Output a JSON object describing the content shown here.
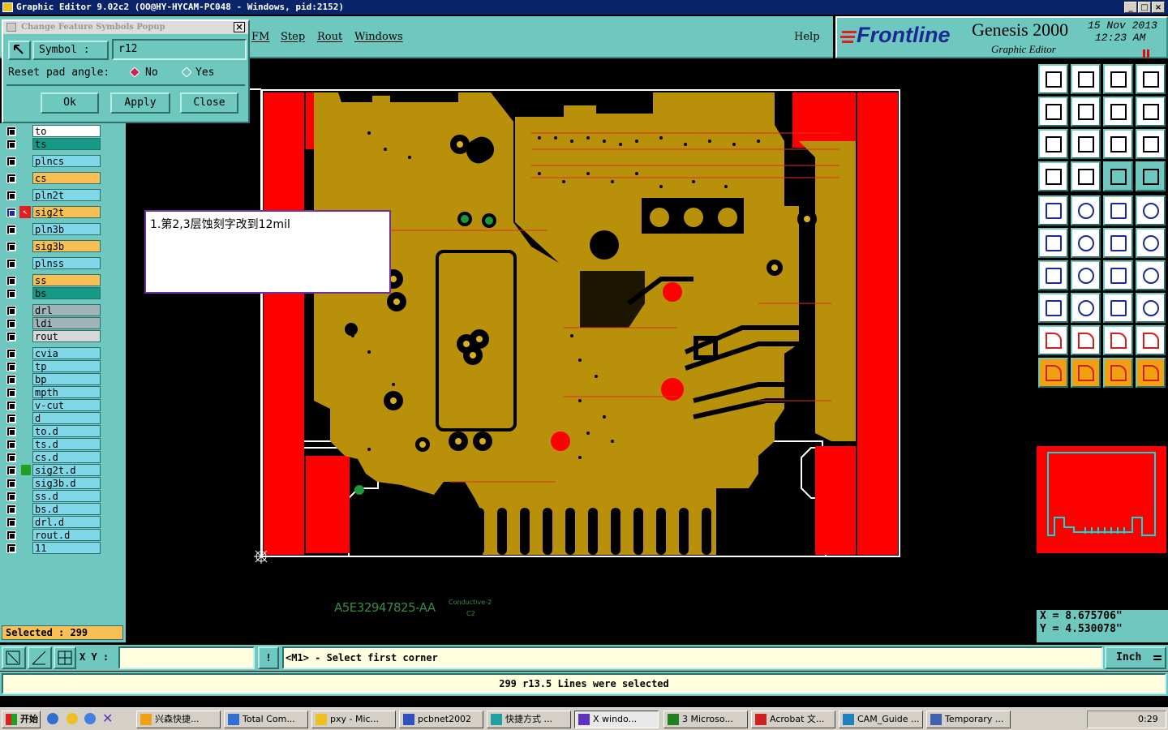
{
  "window": {
    "title": "Graphic Editor 9.02c2 (OO@HY-HYCAM-PC048 - Windows, pid:2152)"
  },
  "menu": [
    "FM",
    "Step",
    "Rout",
    "Windows",
    "Help"
  ],
  "brand": {
    "logo": "Frontline",
    "product": "Genesis 2000",
    "subtitle": "Graphic Editor",
    "date": "15 Nov 2013",
    "time": "12:23 AM"
  },
  "popup": {
    "title": "Change Feature Symbols Popup",
    "symbol_label": "Symbol :",
    "symbol_value": "r12",
    "reset_label": "Reset pad angle:",
    "opt_no": "No",
    "opt_yes": "Yes",
    "ok": "Ok",
    "apply": "Apply",
    "close": "Close"
  },
  "layers": [
    {
      "name": "to",
      "color": "#ffffff"
    },
    {
      "name": "ts",
      "color": "#159a88"
    },
    {
      "name": "plncs",
      "color": "#7fd7e8"
    },
    {
      "name": "cs",
      "color": "#f8c054"
    },
    {
      "name": "pln2t",
      "color": "#7fd7e8"
    },
    {
      "name": "sig2t",
      "color": "#f8c054"
    },
    {
      "name": "pln3b",
      "color": "#7fd7e8"
    },
    {
      "name": "sig3b",
      "color": "#f8c054"
    },
    {
      "name": "plnss",
      "color": "#7fd7e8"
    },
    {
      "name": "ss",
      "color": "#f8c054"
    },
    {
      "name": "bs",
      "color": "#159a88"
    },
    {
      "name": "drl",
      "color": "#a0b4b8"
    },
    {
      "name": "ldi",
      "color": "#a0b4b8"
    },
    {
      "name": "rout",
      "color": "#d8d8d8"
    },
    {
      "name": "cvia",
      "color": "#7fd7e8"
    },
    {
      "name": "tp",
      "color": "#7fd7e8"
    },
    {
      "name": "bp",
      "color": "#7fd7e8"
    },
    {
      "name": "mpth",
      "color": "#7fd7e8"
    },
    {
      "name": "v-cut",
      "color": "#7fd7e8"
    },
    {
      "name": "d",
      "color": "#7fd7e8"
    },
    {
      "name": "to.d",
      "color": "#7fd7e8"
    },
    {
      "name": "ts.d",
      "color": "#7fd7e8"
    },
    {
      "name": "cs.d",
      "color": "#7fd7e8"
    },
    {
      "name": "sig2t.d",
      "color": "#7fd7e8"
    },
    {
      "name": "sig3b.d",
      "color": "#7fd7e8"
    },
    {
      "name": "ss.d",
      "color": "#7fd7e8"
    },
    {
      "name": "bs.d",
      "color": "#7fd7e8"
    },
    {
      "name": "drl.d",
      "color": "#7fd7e8"
    },
    {
      "name": "rout.d",
      "color": "#7fd7e8"
    },
    {
      "name": "11",
      "color": "#7fd7e8"
    }
  ],
  "selected_label": "Selected : 299",
  "annotation": "1.第2,3层蚀刻字改到12mil",
  "board_text": {
    "part": "A5E32947825-AA",
    "layer": "Conductive-2",
    "code": "C2"
  },
  "coords": {
    "x": "X = 8.675706\"",
    "y": "Y = 4.530078\""
  },
  "xy_label": "X Y :",
  "prompt": "<M1> - Select first corner",
  "units": "Inch",
  "status_message": "299 r13.5 Lines were selected",
  "taskbar": {
    "start": "开始",
    "tasks": [
      "兴森快捷...",
      "Total Com...",
      "pxy - Mic...",
      "pcbnet2002",
      "快捷方式 ...",
      "X windo...",
      "3 Microso...",
      "Acrobat 文...",
      "CAM_Guide ...",
      "Temporary ..."
    ],
    "clock": "0:29"
  },
  "colors": {
    "copper": "#b8900a",
    "border_red": "#ff0000",
    "teal": "#6fc8c0"
  }
}
